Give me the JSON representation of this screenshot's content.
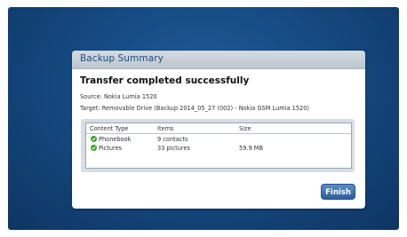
{
  "dialog": {
    "title": "Backup Summary",
    "headline": "Transfer completed successfully",
    "source": "Source: Nokia Lumia 1520",
    "target": "Target: Removable Drive (Backup 2014_05_27 (002) - Nokia GSM Lumia 1520)",
    "table": {
      "columns": [
        "Content Type",
        "Items",
        "Size"
      ],
      "rows": [
        {
          "type": "Phonebook",
          "items": "9 contacts",
          "size": "",
          "status_icon": "check-icon"
        },
        {
          "type": "Pictures",
          "items": "33 pictures",
          "size": "59.9 MB",
          "status_icon": "check-icon"
        }
      ]
    },
    "finish_label": "Finish"
  },
  "colors": {
    "background_blue": "#164a82",
    "title_text": "#1d4d80",
    "check_green": "#3c9b2c",
    "button_blue": "#2c5f9e"
  }
}
